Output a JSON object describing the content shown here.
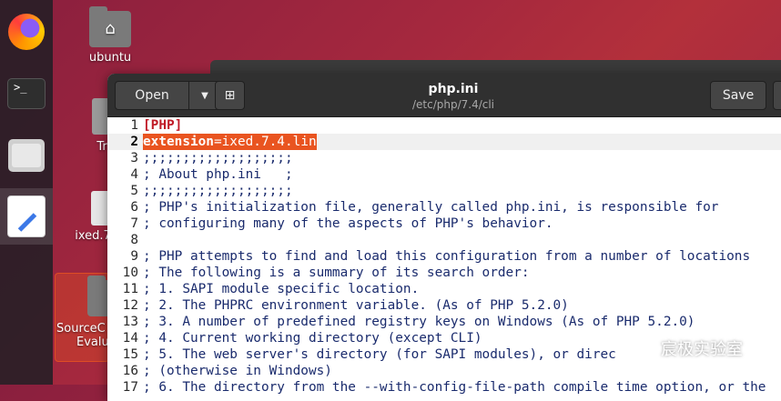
{
  "desktop": {
    "icons": [
      {
        "label": "ubuntu"
      },
      {
        "label": "Tra"
      },
      {
        "label": "ixed.7"
      },
      {
        "label": "SourceC",
        "label2": "Evalu"
      }
    ]
  },
  "dock": {
    "items": [
      "firefox-icon",
      "terminal-icon",
      "files-icon",
      "text-editor-icon"
    ],
    "terminal_glyph": ">_"
  },
  "window": {
    "open_label": "Open",
    "save_label": "Save",
    "title": "php.ini",
    "subtitle": "/etc/php/7.4/cli"
  },
  "editor": {
    "lines": [
      {
        "n": "1",
        "text": "[PHP]"
      },
      {
        "n": "2",
        "key": "extension",
        "rest": "=ixed.7.4.lin"
      },
      {
        "n": "3",
        "text": ";;;;;;;;;;;;;;;;;;;"
      },
      {
        "n": "4",
        "text": "; About php.ini   ;"
      },
      {
        "n": "5",
        "text": ";;;;;;;;;;;;;;;;;;;"
      },
      {
        "n": "6",
        "text": "; PHP's initialization file, generally called php.ini, is responsible for"
      },
      {
        "n": "7",
        "text": "; configuring many of the aspects of PHP's behavior."
      },
      {
        "n": "8",
        "text": ""
      },
      {
        "n": "9",
        "text": "; PHP attempts to find and load this configuration from a number of locations"
      },
      {
        "n": "10",
        "text": "; The following is a summary of its search order:"
      },
      {
        "n": "11",
        "text": "; 1. SAPI module specific location."
      },
      {
        "n": "12",
        "text": "; 2. The PHPRC environment variable. (As of PHP 5.2.0)"
      },
      {
        "n": "13",
        "text": "; 3. A number of predefined registry keys on Windows (As of PHP 5.2.0)"
      },
      {
        "n": "14",
        "text": "; 4. Current working directory (except CLI)"
      },
      {
        "n": "15",
        "text": "; 5. The web server's directory (for SAPI modules), or direc"
      },
      {
        "n": "16",
        "text": "; (otherwise in Windows)"
      },
      {
        "n": "17",
        "text": "; 6. The directory from the --with-config-file-path compile time option, or the"
      }
    ]
  },
  "watermark": {
    "text": "宸极实验室"
  },
  "colors": {
    "accent": "#e95420",
    "headerbar": "#303030",
    "comment": "#1a2b6d",
    "section": "#c01c28"
  }
}
